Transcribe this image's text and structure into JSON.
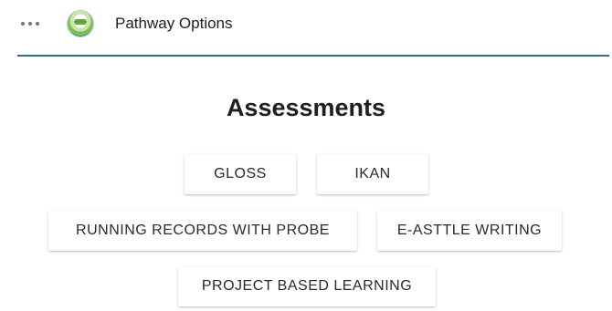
{
  "header": {
    "title": "Pathway Options",
    "menu_icon": "more-horizontal-icon",
    "logo_icon": "aces-logo-icon",
    "divider_color": "#2d6d86"
  },
  "main": {
    "heading": "Assessments",
    "buttons": [
      {
        "label": "GLOSS"
      },
      {
        "label": "IKAN"
      },
      {
        "label": "RUNNING RECORDS WITH PROBE"
      },
      {
        "label": "E-ASTTLE WRITING"
      },
      {
        "label": "PROJECT BASED LEARNING"
      }
    ]
  }
}
